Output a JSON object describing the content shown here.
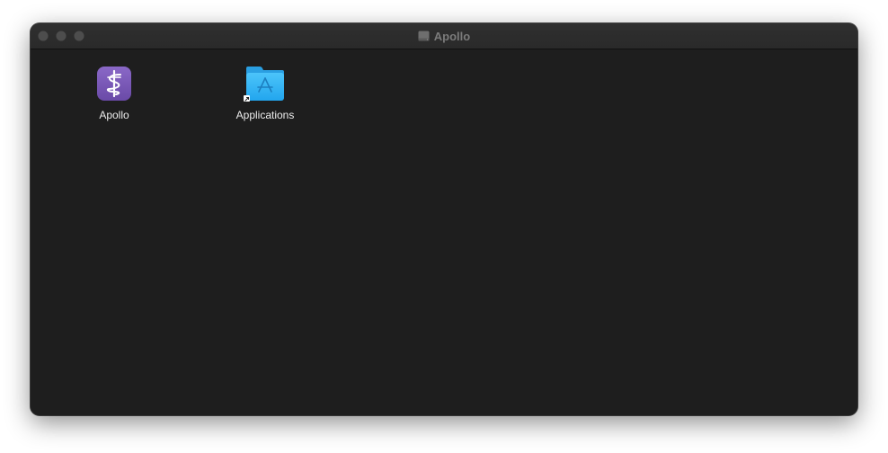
{
  "window": {
    "title": "Apollo",
    "title_icon": "disk-icon",
    "traffic_lights": [
      "close",
      "minimize",
      "zoom"
    ]
  },
  "items": [
    {
      "label": "Apollo",
      "icon": "apollo-app-icon"
    },
    {
      "label": "Applications",
      "icon": "applications-folder-alias-icon"
    }
  ],
  "colors": {
    "window_bg": "#1e1e1e",
    "titlebar_bg": "#2c2c2c",
    "app_icon_purple": "#7a5bb8",
    "folder_blue": "#35b1f2"
  }
}
